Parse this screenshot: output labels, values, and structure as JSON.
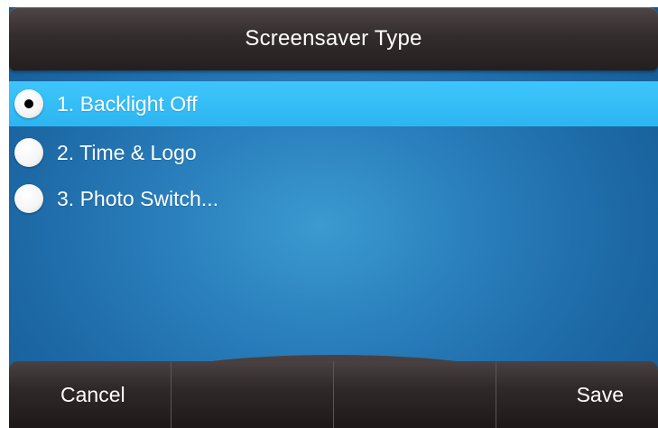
{
  "title": "Screensaver Type",
  "options": [
    {
      "label": "1. Backlight Off",
      "selected": true
    },
    {
      "label": "2. Time & Logo",
      "selected": false
    },
    {
      "label": "3. Photo Switch...",
      "selected": false
    }
  ],
  "softkeys": [
    "Cancel",
    "",
    "",
    "Save"
  ],
  "colors": {
    "background": "#2a80bd",
    "highlight": "#2cb5f1",
    "bar": "#302929",
    "text": "#ffffff"
  }
}
